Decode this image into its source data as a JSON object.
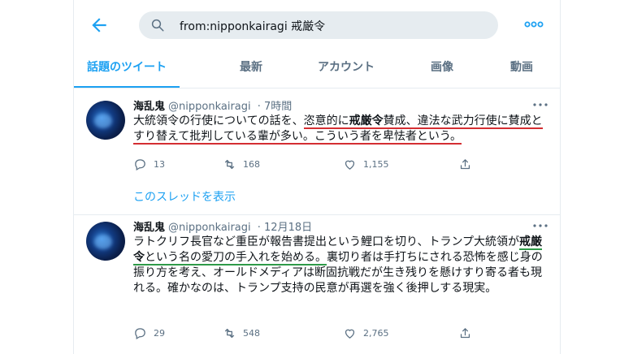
{
  "colors": {
    "accent": "#1da1f2",
    "muted": "#5b7083",
    "highlight_red": "#d42e32",
    "highlight_green": "#2e9a48"
  },
  "search": {
    "query": "from:nipponkairagi 戒厳令"
  },
  "tabs": [
    {
      "label": "話題のツイート",
      "active": true
    },
    {
      "label": "最新",
      "active": false
    },
    {
      "label": "アカウント",
      "active": false
    },
    {
      "label": "画像",
      "active": false
    },
    {
      "label": "動画",
      "active": false
    }
  ],
  "tweets": [
    {
      "name": "海乱鬼",
      "handle": "@nipponkairagi",
      "time": "· 7時間",
      "text": {
        "p1": "大統領令の行使についての話を、",
        "p2": "恣意的に",
        "p3": "戒厳令",
        "p4": "賛成、違法な武力行使に",
        "p5": "賛成とすり替えて批判している輩が多い。こういう者を卑怯者という。"
      },
      "replies": "13",
      "retweets": "168",
      "likes": "1,155",
      "thread_link": "このスレッドを表示"
    },
    {
      "name": "海乱鬼",
      "handle": "@nipponkairagi",
      "time": "· 12月18日",
      "text": {
        "p1": "ラトクリフ長官など重臣が報告書提出という鯉口を切り、トランプ大統領が",
        "p2": "戒厳令",
        "p3": "という名の愛刀の手入れを始める。",
        "p4": "裏切り者は手打ちにされる恐怖を感じ身の振り方を考え、オールドメディアは断固抗戦だが生き残りを懸けすり寄る者も現れる。確かなのは、トランプ支持の民意が再選を強く後押しする現実。"
      },
      "replies": "29",
      "retweets": "548",
      "likes": "2,765"
    }
  ]
}
